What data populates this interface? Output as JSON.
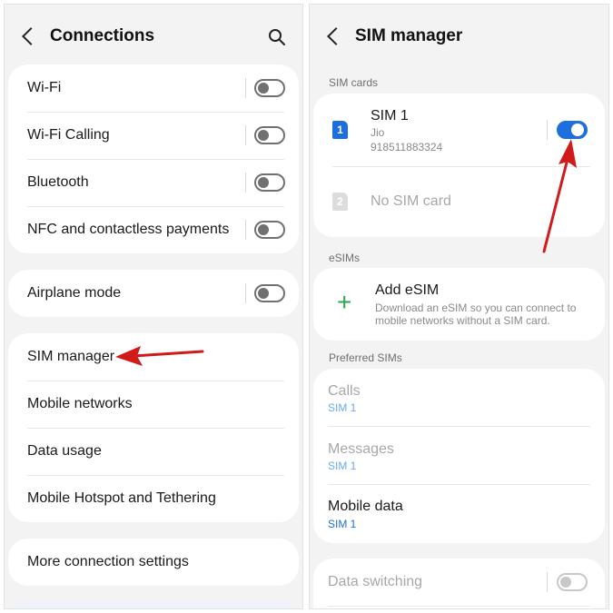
{
  "left": {
    "title": "Connections",
    "group1": [
      {
        "label": "Wi-Fi"
      },
      {
        "label": "Wi-Fi Calling"
      },
      {
        "label": "Bluetooth"
      },
      {
        "label": "NFC and contactless payments"
      }
    ],
    "airplane": {
      "label": "Airplane mode"
    },
    "group3": [
      {
        "label": "SIM manager"
      },
      {
        "label": "Mobile networks"
      },
      {
        "label": "Data usage"
      },
      {
        "label": "Mobile Hotspot and Tethering"
      }
    ],
    "more": {
      "label": "More connection settings"
    }
  },
  "right": {
    "title": "SIM manager",
    "sim_cards_header": "SIM cards",
    "sim1": {
      "badge": "1",
      "title": "SIM 1",
      "carrier": "Jio",
      "number": "918511883324",
      "enabled": true
    },
    "sim2": {
      "badge": "2",
      "title": "No SIM card"
    },
    "esims_header": "eSIMs",
    "add_esim": {
      "title": "Add eSIM",
      "line1": "Download an eSIM so you can connect to",
      "line2": "mobile networks without a SIM card."
    },
    "preferred_header": "Preferred SIMs",
    "calls": {
      "title": "Calls",
      "value": "SIM 1"
    },
    "messages": {
      "title": "Messages",
      "value": "SIM 1"
    },
    "mobile_data": {
      "title": "Mobile data",
      "value": "SIM 1"
    },
    "data_switching": {
      "title": "Data switching"
    }
  },
  "colors": {
    "accent": "#1d6fe0",
    "annotation_arrow": "#d11a1a",
    "add_icon": "#2fa84f"
  },
  "icons": [
    "back-arrow-icon",
    "search-icon",
    "plus-icon",
    "sim-card-icon"
  ]
}
